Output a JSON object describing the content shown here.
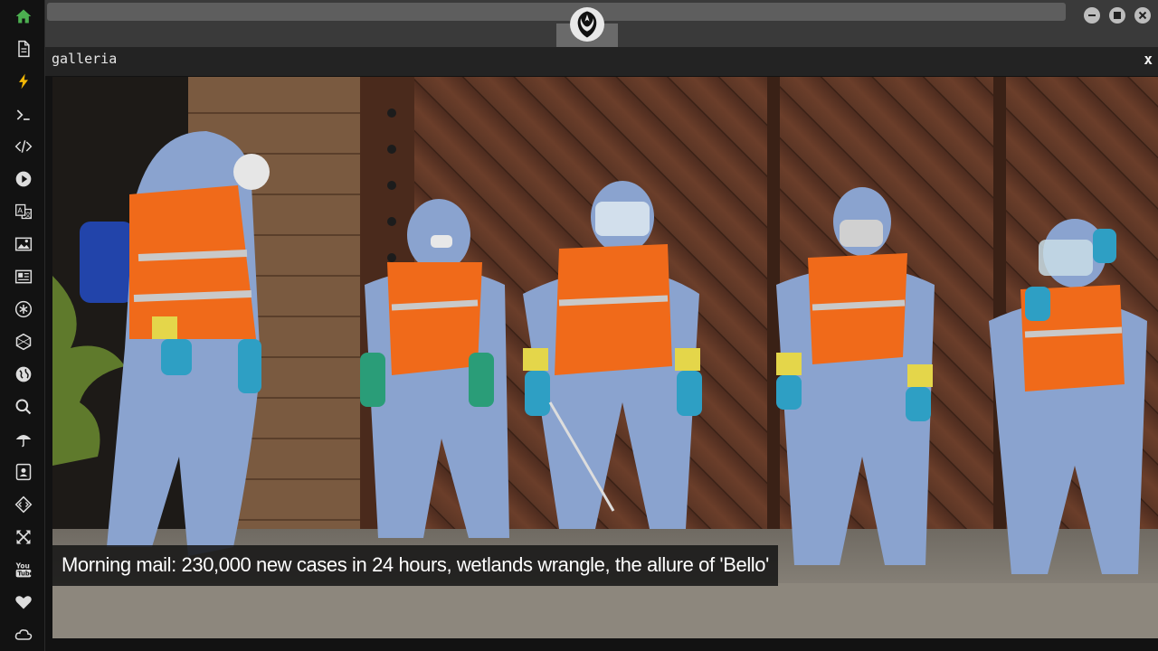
{
  "app": {
    "panel_title": "galleria",
    "close_label": "x"
  },
  "sidebar": {
    "items": [
      {
        "name": "home-icon",
        "active": true
      },
      {
        "name": "document-icon"
      },
      {
        "name": "lightning-icon"
      },
      {
        "name": "terminal-icon"
      },
      {
        "name": "code-icon"
      },
      {
        "name": "play-icon"
      },
      {
        "name": "translate-icon"
      },
      {
        "name": "image-icon"
      },
      {
        "name": "news-icon"
      },
      {
        "name": "asterisk-icon"
      },
      {
        "name": "hexagon-icon"
      },
      {
        "name": "globe-icon"
      },
      {
        "name": "search-icon"
      },
      {
        "name": "umbrella-icon"
      },
      {
        "name": "contact-icon"
      },
      {
        "name": "diamond-code-icon"
      },
      {
        "name": "expand-icon"
      },
      {
        "name": "youtube-icon"
      },
      {
        "name": "heart-icon"
      },
      {
        "name": "cloud-icon"
      }
    ],
    "accent_color": "#4caf50",
    "icon_color": "#dddddd"
  },
  "titlebar": {
    "logo": "rebel-alliance-icon",
    "window_buttons": [
      "minimize-icon",
      "maximize-icon",
      "close-icon"
    ]
  },
  "gallery": {
    "caption": "Morning mail: 230,000 new cases in 24 hours, wetlands wrangle, the allure of 'Bello'"
  }
}
